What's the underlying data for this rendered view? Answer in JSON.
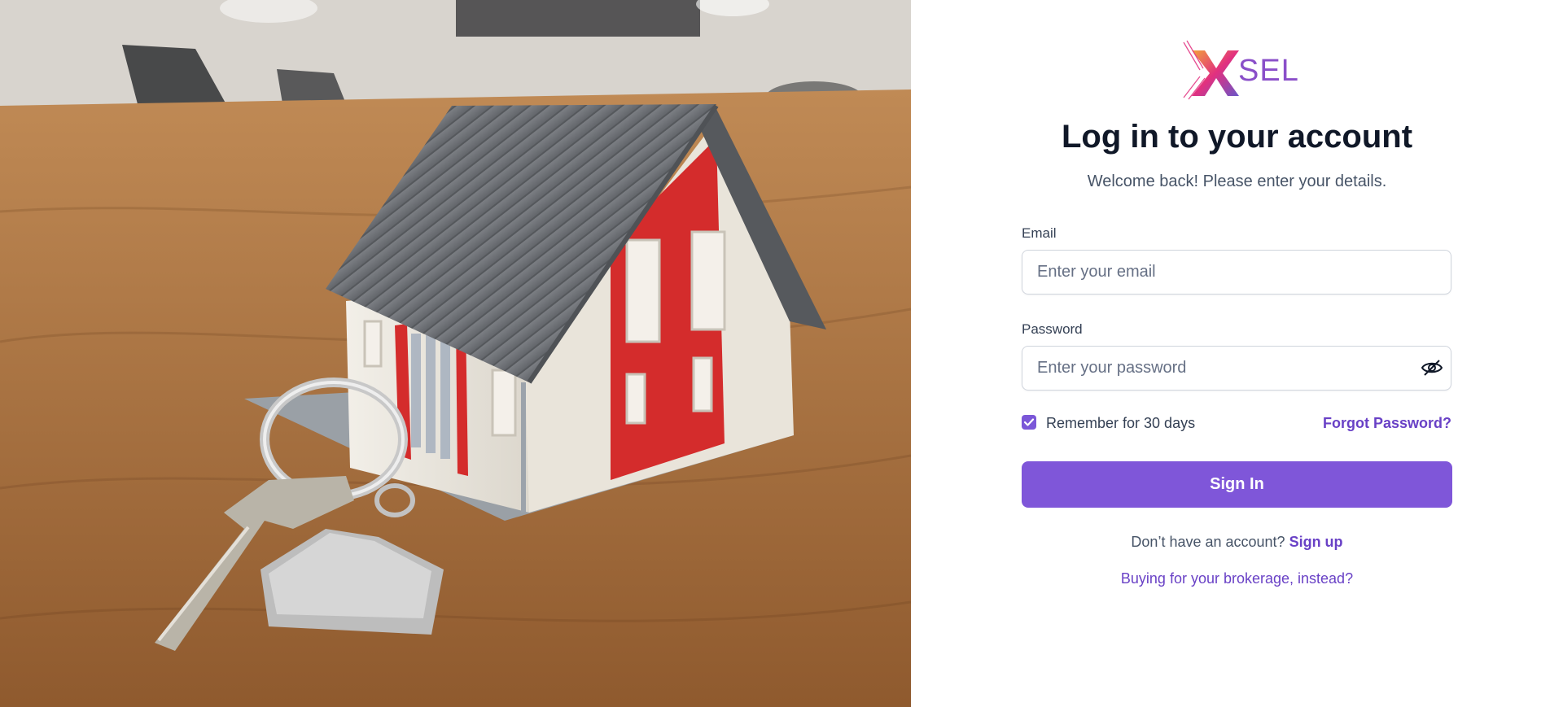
{
  "hero": {
    "image": "house-model-with-keys-photo"
  },
  "brand": {
    "logo_text": "SEL",
    "accent": "#8a4fc9",
    "logo_mark": "x-logo-icon"
  },
  "login": {
    "title": "Log in to your account",
    "subtitle": "Welcome back! Please enter your details.",
    "email_label": "Email",
    "email_placeholder": "Enter your email",
    "email_value": "",
    "password_label": "Password",
    "password_placeholder": "Enter your password",
    "password_value": "",
    "password_toggle_icon": "eye-off-icon",
    "remember_label": "Remember for 30 days",
    "remember_checked": true,
    "forgot_label": "Forgot Password?",
    "signin_label": "Sign In",
    "signup_prompt": "Don’t have an account?",
    "signup_link": "Sign up",
    "brokerage_link": "Buying for your brokerage, instead?"
  },
  "colors": {
    "primary": "#7f56d9",
    "link": "#6941c6",
    "heading": "#101828",
    "body": "#475467"
  }
}
